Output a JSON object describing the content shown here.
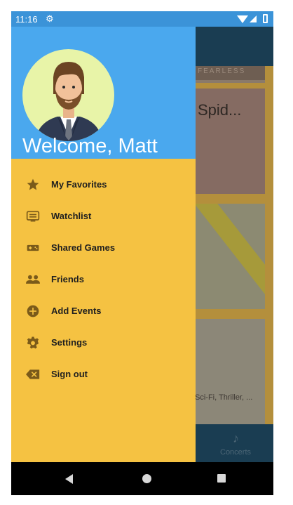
{
  "status_bar": {
    "time": "11:16",
    "settings_icon": "gear-icon",
    "wifi_icon": "wifi-icon",
    "signal_icon": "signal-icon",
    "battery_icon": "battery-icon"
  },
  "drawer": {
    "welcome": "Welcome, Matt",
    "colors": {
      "header": "#4aa8ee",
      "body": "#f5c242",
      "status_bar": "#3b93d8"
    },
    "menu": [
      {
        "label": "My Favorites",
        "icon": "star-icon"
      },
      {
        "label": "Watchlist",
        "icon": "tv-list-icon"
      },
      {
        "label": "Shared Games",
        "icon": "gamepad-icon"
      },
      {
        "label": "Friends",
        "icon": "people-icon"
      },
      {
        "label": "Add Events",
        "icon": "add-circle-icon"
      },
      {
        "label": "Settings",
        "icon": "gear-icon"
      },
      {
        "label": "Sign out",
        "icon": "backspace-icon"
      }
    ]
  },
  "background": {
    "card_caption": "FEARLESS",
    "card_title": "Spid...",
    "card_genre": "Sci-Fi, Thriller, ...",
    "bottom_tab": "Concerts",
    "bottom_tab_icon": "music-note-icon"
  },
  "system_nav": {
    "back_icon": "back-triangle-icon",
    "home_icon": "home-circle-icon",
    "recents_icon": "recents-square-icon"
  }
}
